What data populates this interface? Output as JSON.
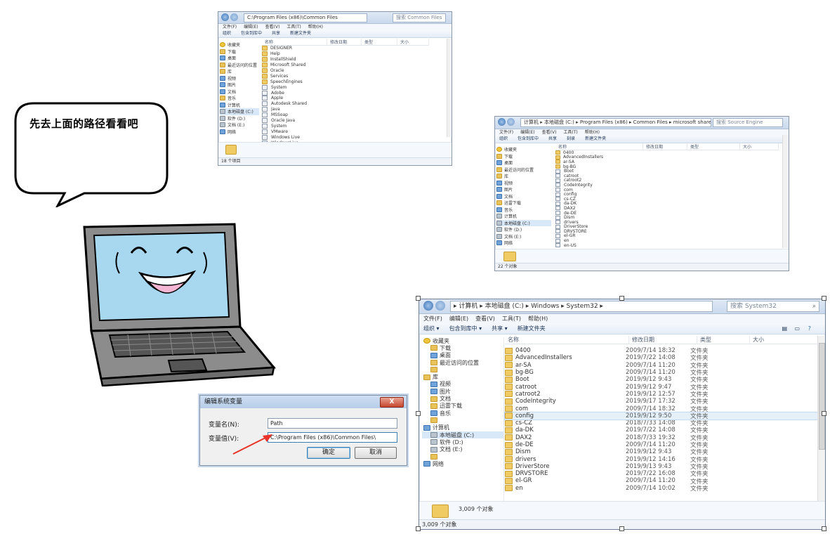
{
  "bubble": {
    "text": "先去上面的路径看看吧"
  },
  "win1": {
    "address": "C:\\Program Files (x86)\\Common Files",
    "search": "搜索 Common Files",
    "menu": [
      "文件(F)",
      "编辑(E)",
      "查看(V)",
      "工具(T)",
      "帮助(H)"
    ],
    "toolbar": [
      "组织",
      "包含到库中",
      "共享",
      "新建文件夹"
    ],
    "tree": [
      "收藏夹",
      "下载",
      "桌面",
      "最近访问的位置",
      "库",
      "视频",
      "图片",
      "文档",
      "音乐",
      "计算机",
      "本地磁盘 (C:)",
      "软件 (D:)",
      "文档 (E:)",
      "网络"
    ],
    "columns": [
      "名称",
      "修改日期",
      "类型",
      "大小"
    ],
    "rows": [
      "DESIGNER",
      "Help",
      "InstallShield",
      "Microsoft Shared",
      "Oracle",
      "Services",
      "SpeechEngines",
      "System",
      "Adobe",
      "Apple",
      "Autodesk Shared",
      "Java",
      "MSSoap",
      "Oracle Java",
      "System",
      "VMware",
      "Windows Live",
      "WindowsLive"
    ],
    "status": "18 个项目"
  },
  "win2": {
    "address": "计算机 ▸ 本地磁盘 (C:) ▸ Program Files (x86) ▸ Common Files ▸ microsoft shared ▸ Source Engine",
    "search": "搜索 Source Engine",
    "menu": [
      "文件(F)",
      "编辑(E)",
      "查看(V)",
      "工具(T)",
      "帮助(H)"
    ],
    "toolbar": [
      "组织",
      "包含到库中",
      "共享",
      "刻录",
      "新建文件夹"
    ],
    "tree": [
      "收藏夹",
      "下载",
      "桌面",
      "最近访问的位置",
      "库",
      "视频",
      "图片",
      "文档",
      "迅雷下载",
      "音乐",
      "计算机",
      "本地磁盘 (C:)",
      "软件 (D:)",
      "文档 (E:)",
      "网络"
    ],
    "columns": [
      "名称",
      "修改日期",
      "类型",
      "大小"
    ],
    "rows": [
      "0400",
      "AdvancedInstallers",
      "ar-SA",
      "bg-BG",
      "Boot",
      "catroot",
      "catroot2",
      "CodeIntegrity",
      "com",
      "config",
      "cs-CZ",
      "da-DK",
      "DAX2",
      "de-DE",
      "Dism",
      "drivers",
      "DriverStore",
      "DRVSTORE",
      "el-GR",
      "en",
      "en-US"
    ],
    "status": "22 个对象"
  },
  "win3": {
    "breadcrumb": [
      "计算机",
      "本地磁盘 (C:)",
      "Windows",
      "System32"
    ],
    "search": "搜索 System32",
    "menu": [
      "文件(F)",
      "编辑(E)",
      "查看(V)",
      "工具(T)",
      "帮助(H)"
    ],
    "toolbar": [
      "组织 ▾",
      "包含到库中 ▾",
      "共享 ▾",
      "新建文件夹"
    ],
    "tree": [
      {
        "label": "收藏夹",
        "icon": "star"
      },
      {
        "label": "下载",
        "icon": "folder"
      },
      {
        "label": "桌面",
        "icon": "blue"
      },
      {
        "label": "最近访问的位置",
        "icon": "folder"
      },
      {
        "label": "",
        "icon": "none"
      },
      {
        "label": "库",
        "icon": "folder"
      },
      {
        "label": "视频",
        "icon": "blue"
      },
      {
        "label": "图片",
        "icon": "blue"
      },
      {
        "label": "文档",
        "icon": "folder"
      },
      {
        "label": "迅雷下载",
        "icon": "folder"
      },
      {
        "label": "音乐",
        "icon": "blue"
      },
      {
        "label": "",
        "icon": "none"
      },
      {
        "label": "计算机",
        "icon": "blue"
      },
      {
        "label": "本地磁盘 (C:)",
        "icon": "drive"
      },
      {
        "label": "软件 (D:)",
        "icon": "drive"
      },
      {
        "label": "文档 (E:)",
        "icon": "drive"
      },
      {
        "label": "",
        "icon": "none"
      },
      {
        "label": "网络",
        "icon": "blue"
      }
    ],
    "columns": [
      "名称",
      "修改日期",
      "类型",
      "大小"
    ],
    "rows": [
      {
        "name": "0400",
        "date": "2009/7/14 18:32",
        "type": "文件夹"
      },
      {
        "name": "AdvancedInstallers",
        "date": "2019/7/22 14:08",
        "type": "文件夹"
      },
      {
        "name": "ar-SA",
        "date": "2009/7/14 11:20",
        "type": "文件夹"
      },
      {
        "name": "bg-BG",
        "date": "2009/7/14 11:20",
        "type": "文件夹"
      },
      {
        "name": "Boot",
        "date": "2019/9/12 9:43",
        "type": "文件夹"
      },
      {
        "name": "catroot",
        "date": "2019/9/12 9:47",
        "type": "文件夹"
      },
      {
        "name": "catroot2",
        "date": "2019/9/12 12:57",
        "type": "文件夹"
      },
      {
        "name": "CodeIntegrity",
        "date": "2019/9/17 17:32",
        "type": "文件夹"
      },
      {
        "name": "com",
        "date": "2009/7/14 18:32",
        "type": "文件夹"
      },
      {
        "name": "config",
        "date": "2019/9/12 9:50",
        "type": "文件夹"
      },
      {
        "name": "cs-CZ",
        "date": "2018/7/33 14:08",
        "type": "文件夹"
      },
      {
        "name": "da-DK",
        "date": "2019/7/22 14:08",
        "type": "文件夹"
      },
      {
        "name": "DAX2",
        "date": "2018/7/33 19:32",
        "type": "文件夹"
      },
      {
        "name": "de-DE",
        "date": "2009/7/14 11:20",
        "type": "文件夹"
      },
      {
        "name": "Dism",
        "date": "2019/9/12 9:43",
        "type": "文件夹"
      },
      {
        "name": "drivers",
        "date": "2019/9/12 14:16",
        "type": "文件夹"
      },
      {
        "name": "DriverStore",
        "date": "2019/9/13 9:43",
        "type": "文件夹"
      },
      {
        "name": "DRVSTORE",
        "date": "2019/7/22 16:08",
        "type": "文件夹"
      },
      {
        "name": "el-GR",
        "date": "2009/7/14 11:20",
        "type": "文件夹"
      },
      {
        "name": "en",
        "date": "2009/7/14 10:02",
        "type": "文件夹"
      }
    ],
    "detail_count": "3,009 个对象",
    "status": "3,009 个对象"
  },
  "dialog": {
    "title": "编辑系统变量",
    "close": "X",
    "name_label": "变量名(N):",
    "name_value": "Path",
    "value_label": "变量值(V):",
    "value_value": "C:\\Program Files (x86)\\Common Files\\",
    "ok": "确定",
    "cancel": "取消"
  },
  "colors": {
    "arrow": "#e8332a",
    "laptop_body": "#8c8c8c",
    "screen": "#a8d8f0",
    "folder": "#f0ca62"
  }
}
